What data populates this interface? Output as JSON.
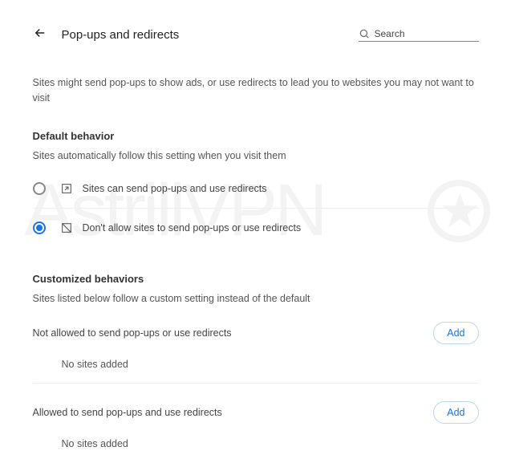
{
  "header": {
    "title": "Pop-ups and redirects",
    "search_placeholder": "Search"
  },
  "intro": "Sites might send pop-ups to show ads, or use redirects to lead you to websites you may not want to visit",
  "default_behavior": {
    "heading": "Default behavior",
    "sub": "Sites automatically follow this setting when you visit them",
    "options": [
      {
        "label": "Sites can send pop-ups and use redirects",
        "selected": false
      },
      {
        "label": "Don't allow sites to send pop-ups or use redirects",
        "selected": true
      }
    ]
  },
  "customized": {
    "heading": "Customized behaviors",
    "sub": "Sites listed below follow a custom setting instead of the default",
    "sections": [
      {
        "title": "Not allowed to send pop-ups or use redirects",
        "add_label": "Add",
        "empty": "No sites added"
      },
      {
        "title": "Allowed to send pop-ups and use redirects",
        "add_label": "Add",
        "empty": "No sites added"
      }
    ]
  },
  "watermark": "AstrillVPN"
}
